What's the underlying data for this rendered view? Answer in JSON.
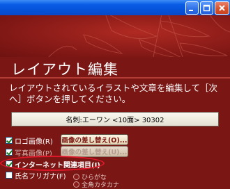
{
  "window": {
    "controls": [
      "minimize",
      "maximize",
      "close"
    ]
  },
  "heading": "レイアウト編集",
  "instructions": "レイアウトされているイラストや文章を編集して［次へ］ボタンを押してください。",
  "name_box": "名刺:エーワン <10面> 30302",
  "options": {
    "logo": {
      "label": "ロゴ画像(R)",
      "checked": true
    },
    "photo": {
      "label": "写真画像(P)",
      "checked": true
    },
    "internet": {
      "label": "インターネット関連項目(I)",
      "checked": true
    },
    "furigana": {
      "label": "氏名フリガナ(F)",
      "checked": false
    }
  },
  "buttons": {
    "logo_swap": "画像の差し替え(O)...",
    "photo_swap": "画像の差し替え(U)..."
  },
  "furigana_styles": [
    "ひらがな",
    "全角カタカナ"
  ],
  "colors": {
    "background": "#7a1614",
    "titlebar": "#0a5ce6",
    "highlight_ring": "#e0182a"
  }
}
